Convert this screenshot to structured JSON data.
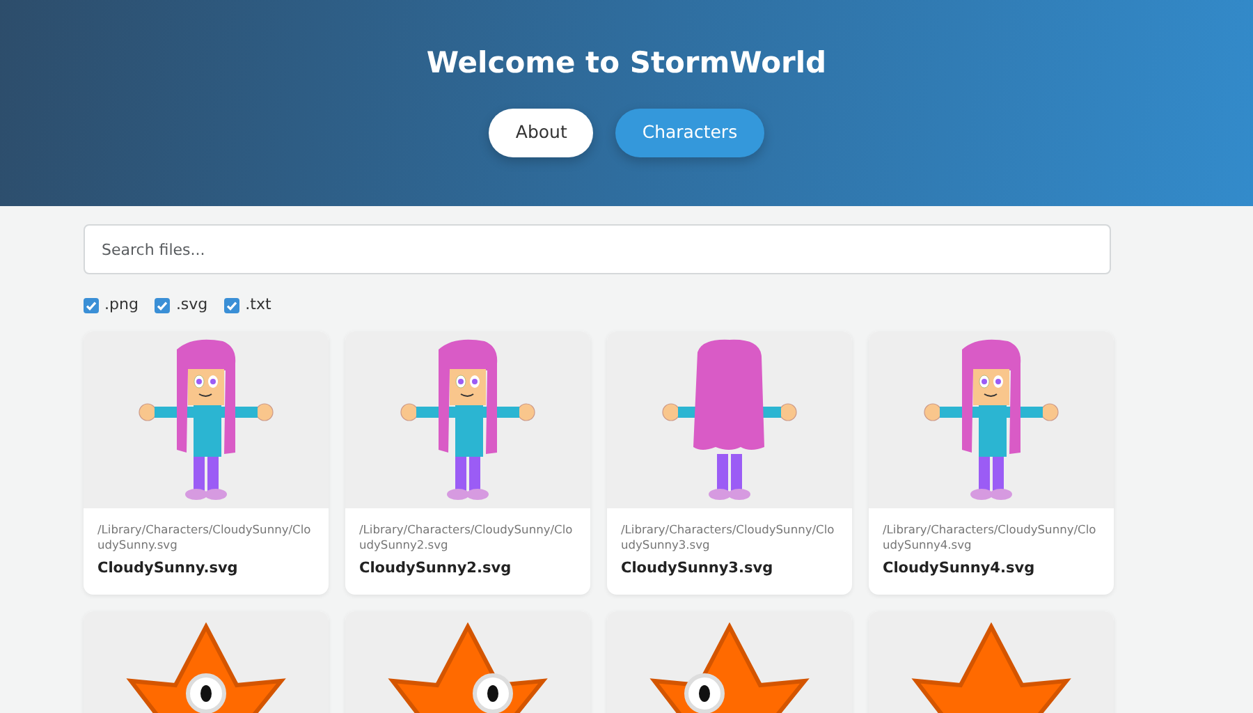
{
  "header": {
    "title": "Welcome to StormWorld"
  },
  "nav": [
    {
      "label": "About",
      "selected": false
    },
    {
      "label": "Characters",
      "selected": true
    }
  ],
  "search": {
    "placeholder": "Search files..."
  },
  "filters": [
    {
      "label": ".png",
      "checked": true
    },
    {
      "label": ".svg",
      "checked": true
    },
    {
      "label": ".txt",
      "checked": true
    }
  ],
  "files": [
    {
      "kind": "girl-front",
      "path": "/Library/Characters/CloudySunny/CloudySunny.svg",
      "name": "CloudySunny.svg"
    },
    {
      "kind": "girl-front",
      "path": "/Library/Characters/CloudySunny/CloudySunny2.svg",
      "name": "CloudySunny2.svg"
    },
    {
      "kind": "girl-back",
      "path": "/Library/Characters/CloudySunny/CloudySunny3.svg",
      "name": "CloudySunny3.svg"
    },
    {
      "kind": "girl-front",
      "path": "/Library/Characters/CloudySunny/CloudySunny4.svg",
      "name": "CloudySunny4.svg"
    },
    {
      "kind": "star-front"
    },
    {
      "kind": "star-right"
    },
    {
      "kind": "star-left"
    },
    {
      "kind": "star-back"
    }
  ]
}
